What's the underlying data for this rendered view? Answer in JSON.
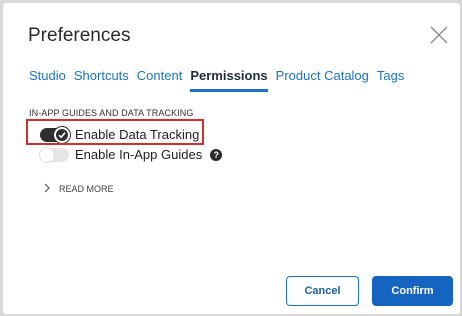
{
  "dialog": {
    "title": "Preferences",
    "close_icon": "close-icon"
  },
  "tabs": [
    {
      "label": "Studio",
      "active": false
    },
    {
      "label": "Shortcuts",
      "active": false
    },
    {
      "label": "Content",
      "active": false
    },
    {
      "label": "Permissions",
      "active": true
    },
    {
      "label": "Product Catalog",
      "active": false
    },
    {
      "label": "Tags",
      "active": false
    }
  ],
  "section": {
    "label": "IN-APP GUIDES AND DATA TRACKING",
    "toggles": [
      {
        "label": "Enable Data Tracking",
        "on": true
      },
      {
        "label": "Enable In-App Guides",
        "on": false,
        "help_icon": "question-circle-icon"
      }
    ],
    "read_more": "READ MORE"
  },
  "buttons": {
    "cancel": "Cancel",
    "confirm": "Confirm"
  },
  "colors": {
    "accent": "#1a73c8",
    "confirm_bg": "#1565c0",
    "highlight": "#d32f2f",
    "toggle_on": "#2f2f2f"
  }
}
